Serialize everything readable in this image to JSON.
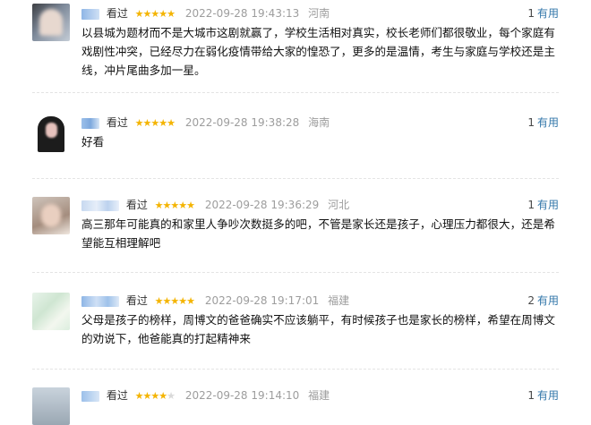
{
  "reviews": [
    {
      "watched": "看过",
      "stars": 5,
      "star_text": "★★★★★",
      "time": "2022-09-28 19:43:13",
      "location": "河南",
      "useful_count": "1",
      "useful_label": "有用",
      "content": "以县城为题材而不是大城市这剧就赢了，学校生活相对真实，校长老师们都很敬业，每个家庭有戏剧性冲突，已经尽力在弱化疫情带给大家的惶恐了，更多的是温情，考生与家庭与学校还是主线，冲片尾曲多加一星。"
    },
    {
      "watched": "看过",
      "stars": 5,
      "star_text": "★★★★★",
      "time": "2022-09-28 19:38:28",
      "location": "海南",
      "useful_count": "1",
      "useful_label": "有用",
      "content": "好看"
    },
    {
      "watched": "看过",
      "stars": 5,
      "star_text": "★★★★★",
      "time": "2022-09-28 19:36:29",
      "location": "河北",
      "useful_count": "1",
      "useful_label": "有用",
      "content": "高三那年可能真的和家里人争吵次数挺多的吧，不管是家长还是孩子，心理压力都很大，还是希望能互相理解吧"
    },
    {
      "watched": "看过",
      "stars": 5,
      "star_text": "★★★★★",
      "time": "2022-09-28 19:17:01",
      "location": "福建",
      "useful_count": "2",
      "useful_label": "有用",
      "content": "父母是孩子的榜样，周博文的爸爸确实不应该躺平，有时候孩子也是家长的榜样，希望在周博文的劝说下，他爸能真的打起精神来"
    },
    {
      "watched": "看过",
      "stars": 4,
      "star_text": "★★★★",
      "star_off_text": "★",
      "time": "2022-09-28 19:14:10",
      "location": "福建",
      "useful_count": "1",
      "useful_label": "有用",
      "content": ""
    }
  ],
  "colors": {
    "link": "#3377aa",
    "star_on": "#f4b400",
    "star_off": "#d9d9d9",
    "meta_gray": "#9d9d9d",
    "divider": "#e4e4e4"
  },
  "icons": [
    "star-icon",
    "avatar-image"
  ]
}
